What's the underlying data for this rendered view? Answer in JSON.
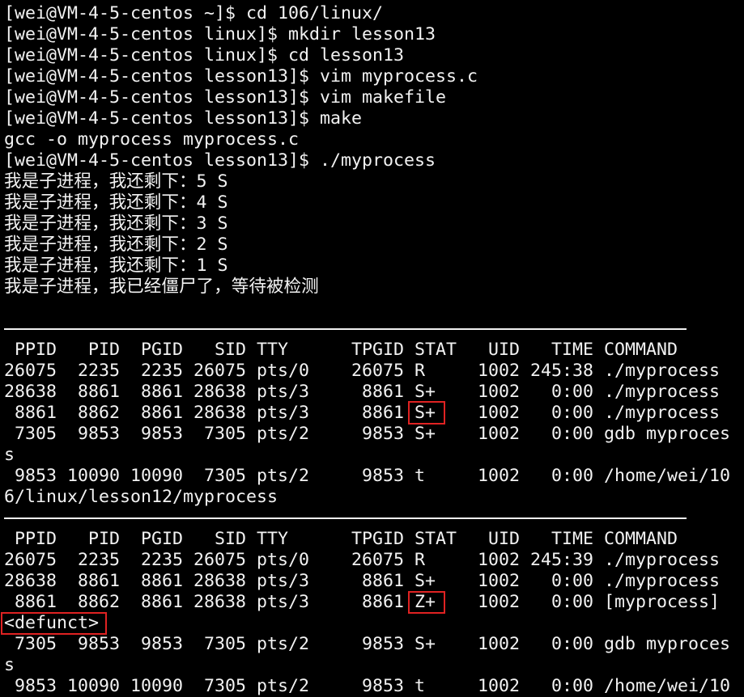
{
  "terminal": {
    "background": "#000000",
    "foreground": "#f2f2f2",
    "highlight_color": "#e02222",
    "lines": [
      "[wei@VM-4-5-centos ~]$ cd 106/linux/",
      "[wei@VM-4-5-centos linux]$ mkdir lesson13",
      "[wei@VM-4-5-centos linux]$ cd lesson13",
      "[wei@VM-4-5-centos lesson13]$ vim myprocess.c",
      "[wei@VM-4-5-centos lesson13]$ vim makefile",
      "[wei@VM-4-5-centos lesson13]$ make",
      "gcc -o myprocess myprocess.c",
      "[wei@VM-4-5-centos lesson13]$ ./myprocess",
      "我是子进程，我还剩下：5 S",
      "我是子进程，我还剩下：4 S",
      "我是子进程，我还剩下：3 S",
      "我是子进程，我还剩下：2 S",
      "我是子进程，我还剩下：1 S",
      "我是子进程，我已经僵尸了，等待被检测",
      "",
      "",
      " PPID   PID  PGID   SID TTY      TPGID STAT   UID   TIME COMMAND",
      "26075  2235  2235 26075 pts/0    26075 R     1002 245:38 ./myprocess",
      "28638  8861  8861 28638 pts/3     8861 S+    1002   0:00 ./myprocess",
      " 8861  8862  8861 28638 pts/3     8861 S+    1002   0:00 ./myprocess",
      " 7305  9853  9853  7305 pts/2     9853 S+    1002   0:00 gdb myproces",
      "s",
      " 9853 10090 10090  7305 pts/2     9853 t     1002   0:00 /home/wei/10",
      "6/linux/lesson12/myprocess",
      "",
      " PPID   PID  PGID   SID TTY      TPGID STAT   UID   TIME COMMAND",
      "26075  2235  2235 26075 pts/0    26075 R     1002 245:39 ./myprocess",
      "28638  8861  8861 28638 pts/3     8861 S+    1002   0:00 ./myprocess",
      " 8861  8862  8861 28638 pts/3     8861 Z+    1002   0:00 [myprocess]",
      "<defunct>",
      " 7305  9853  9853  7305 pts/2     9853 S+    1002   0:00 gdb myproces",
      "s",
      " 9853 10090 10090  7305 pts/2     9853 t     1002   0:00 /home/wei/10"
    ]
  }
}
